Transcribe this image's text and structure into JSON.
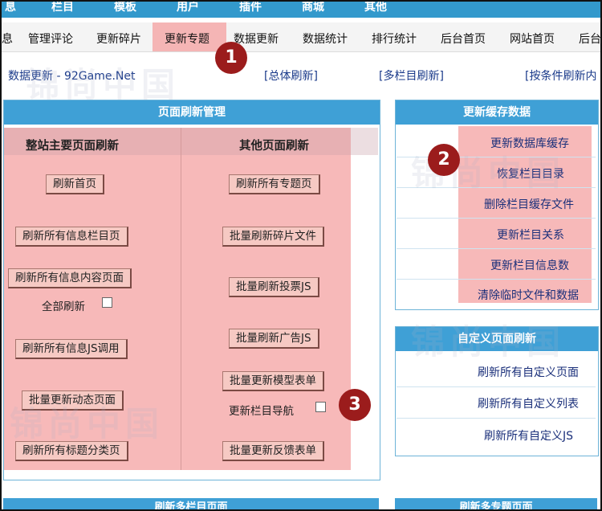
{
  "top_menu": [
    "息",
    "栏目",
    "模板",
    "用户",
    "插件",
    "商城",
    "其他"
  ],
  "nav": [
    "息",
    "管理评论",
    "更新碎片",
    "更新专题",
    "数据更新",
    "数据统计",
    "排行统计",
    "后台首页",
    "网站首页",
    "后台"
  ],
  "breadcrumb": {
    "location": "数据更新 - 92Game.Net",
    "links": [
      "[总体刷新]",
      "[多栏目刷新]",
      "[按条件刷新内"
    ]
  },
  "watermark": "锦尚中国",
  "left_panel": {
    "title": "页面刷新管理",
    "col1_head": "整站主要页面刷新",
    "col2_head": "其他页面刷新",
    "col1_buttons": [
      "刷新首页",
      "刷新所有信息栏目页",
      "刷新所有信息内容页面",
      "刷新所有信息JS调用",
      "批量更新动态页面",
      "刷新所有标题分类页"
    ],
    "col2_buttons": [
      "刷新所有专题页",
      "批量刷新碎片文件",
      "批量刷新投票JS",
      "批量刷新广告JS",
      "批量更新模型表单",
      "批量更新反馈表单"
    ],
    "all_refresh_label": "全部刷新",
    "nav_update_label": "更新栏目导航"
  },
  "cache_panel": {
    "title": "更新缓存数据",
    "links": [
      "更新数据库缓存",
      "恢复栏目目录",
      "删除栏目缓存文件",
      "更新栏目关系",
      "更新栏目信息数",
      "清除临时文件和数据"
    ]
  },
  "custom_panel": {
    "title": "自定义页面刷新",
    "links": [
      "刷新所有自定义页面",
      "刷新所有自定义列表",
      "刷新所有自定义JS"
    ]
  },
  "bottom_heads": [
    "刷新多栏目页面",
    "刷新多专题页面"
  ],
  "badges": [
    "1",
    "2",
    "3"
  ],
  "colors": {
    "header_blue": "#3fa0d6",
    "highlight": "#f7b9b9",
    "badge": "#9b1c1c",
    "link": "#1a2f7a"
  }
}
